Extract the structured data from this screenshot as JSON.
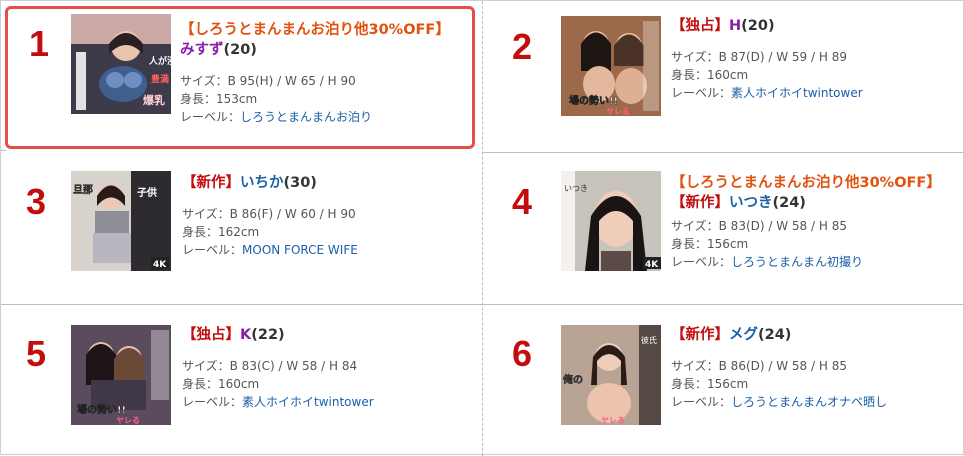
{
  "ranking": [
    {
      "rank": "1",
      "promo": "【しろうとまんまんお泊り他30%OFF】",
      "tag": "",
      "name": "みすず",
      "age": "(20)",
      "size": "サイズ：B 95(H) / W 65 / H 90",
      "height": "身長：153cm",
      "label_prefix": "レーベル：",
      "label": "しろうとまんまんお泊り",
      "highlight": true,
      "name_color": "#8a1ea6",
      "thumb_text": [
        "人が浸",
        "豊満",
        "爆乳"
      ]
    },
    {
      "rank": "2",
      "promo": "",
      "tag": "【独占】",
      "name": "H",
      "age": "(20)",
      "size": "サイズ：B 87(D) / W 59 / H 89",
      "height": "身長：160cm",
      "label_prefix": "レーベル：",
      "label": "素人ホイホイtwintower",
      "highlight": false,
      "name_color": "#8a1ea6",
      "thumb_text": [
        "場の勢い!!",
        "ヤレる"
      ]
    },
    {
      "rank": "3",
      "promo": "",
      "tag": "【新作】",
      "name": "いちか",
      "age": "(30)",
      "size": "サイズ：B 86(F) / W 60 / H 90",
      "height": "身長：162cm",
      "label_prefix": "レーベル：",
      "label": "MOON FORCE WIFE",
      "highlight": false,
      "name_color": "#1b5fa8",
      "thumb_text": [
        "子供",
        "旦那",
        "4K"
      ]
    },
    {
      "rank": "4",
      "promo": "【しろうとまんまんお泊り他30%OFF】",
      "tag": "【新作】",
      "name": "いつき",
      "age": "(24)",
      "size": "サイズ：B 83(D) / W 58 / H 85",
      "height": "身長：156cm",
      "label_prefix": "レーベル：",
      "label": "しろうとまんまん初撮り",
      "highlight": false,
      "name_color": "#1b5fa8",
      "thumb_text": [
        "いつき",
        "4K"
      ]
    },
    {
      "rank": "5",
      "promo": "",
      "tag": "【独占】",
      "name": "K",
      "age": "(22)",
      "size": "サイズ：B 83(C) / W 58 / H 84",
      "height": "身長：160cm",
      "label_prefix": "レーベル：",
      "label": "素人ホイホイtwintower",
      "highlight": false,
      "name_color": "#8a1ea6",
      "thumb_text": [
        "場の勢い!!",
        "ヤレる"
      ]
    },
    {
      "rank": "6",
      "promo": "",
      "tag": "【新作】",
      "name": "メグ",
      "age": "(24)",
      "size": "サイズ：B 86(D) / W 58 / H 85",
      "height": "身長：156cm",
      "label_prefix": "レーベル：",
      "label": "しろうとまんまんオナペ晒し",
      "highlight": false,
      "name_color": "#1b5fa8",
      "thumb_text": [
        "彼氏",
        "俺の",
        "ヤレる"
      ]
    }
  ]
}
